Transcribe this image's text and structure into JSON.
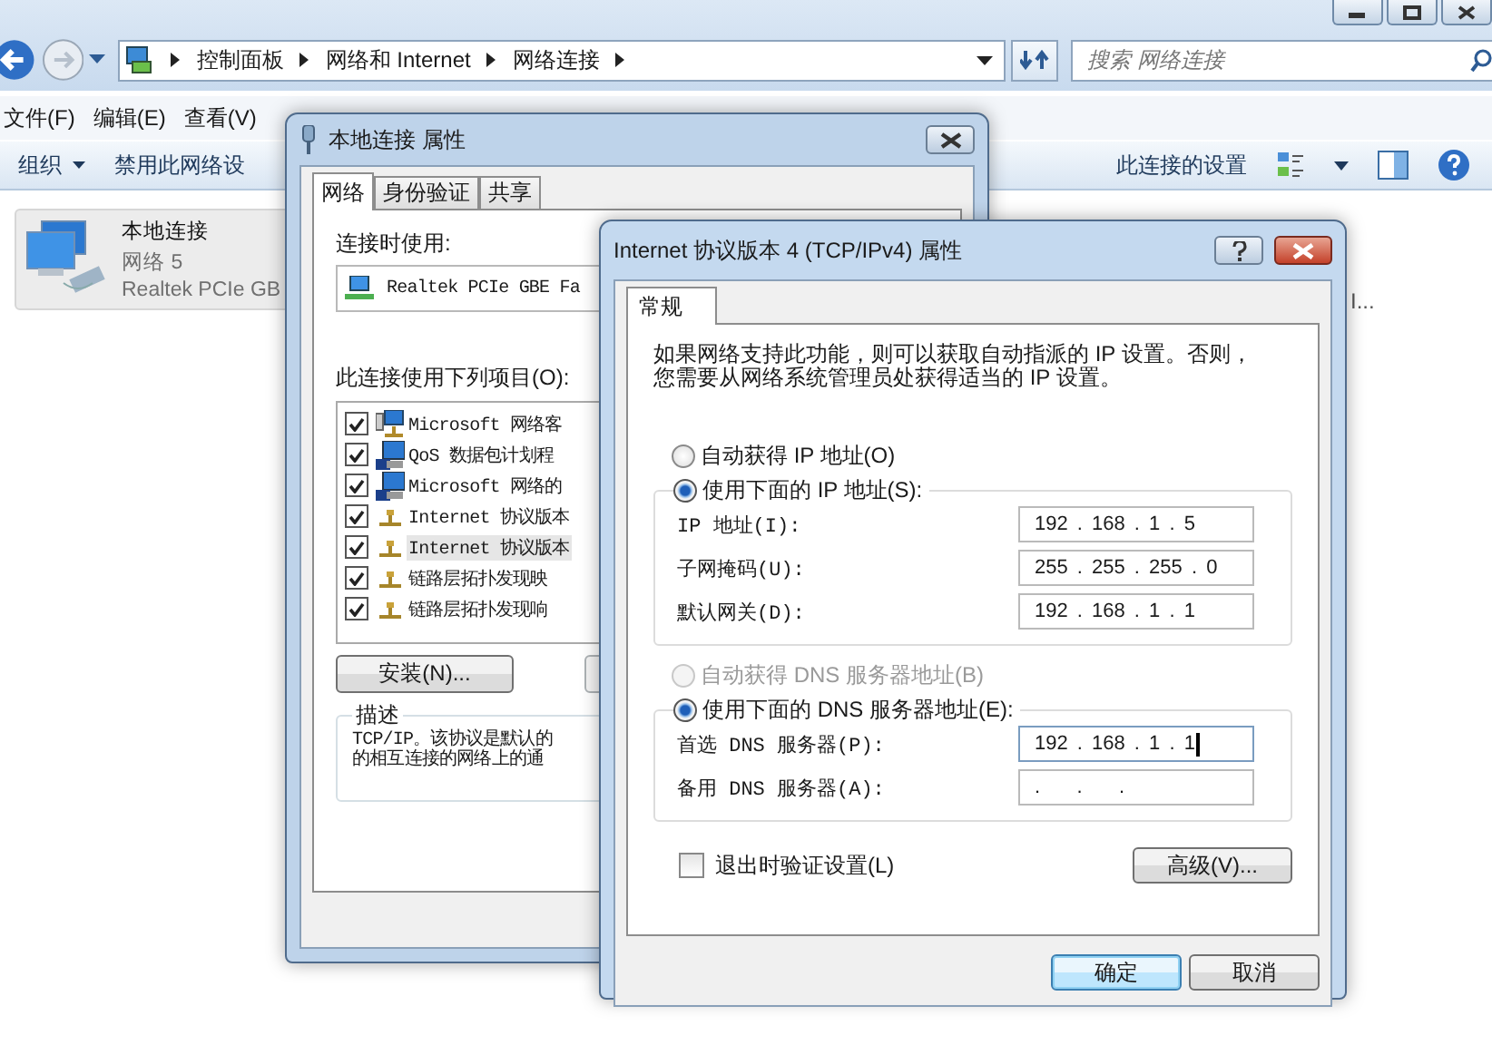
{
  "explorer": {
    "address": {
      "path": [
        "控制面板",
        "网络和 Internet",
        "网络连接"
      ]
    },
    "search": {
      "placeholder": "搜索 网络连接"
    },
    "menu": [
      "文件(F)",
      "编辑(E)",
      "查看(V)"
    ],
    "toolbar": [
      {
        "label": "组织",
        "kind": "dropdown"
      },
      {
        "label": "禁用此网络设",
        "kind": "command"
      }
    ],
    "toolbar_right_command": "此连接的设置",
    "connections": [
      {
        "name": "本地连接",
        "network": "网络 5",
        "adapter": "Realtek PCIe GB",
        "selected": true
      }
    ],
    "connection_2_fragment": "I..."
  },
  "properties_dialog": {
    "title": "本地连接 属性",
    "tabs": [
      {
        "label": "网络",
        "selected": true
      },
      {
        "label": "身份验证",
        "selected": false
      },
      {
        "label": "共享",
        "selected": false
      }
    ],
    "connect_using_label": "连接时使用:",
    "adapter": "Realtek PCIe GBE Fa",
    "items_label": "此连接使用下列项目(O):",
    "items": [
      {
        "label": "Microsoft 网络客",
        "kind": "client",
        "checked": true,
        "selected": false
      },
      {
        "label": "QoS 数据包计划程",
        "kind": "service",
        "checked": true,
        "selected": false
      },
      {
        "label": "Microsoft 网络的",
        "kind": "service",
        "checked": true,
        "selected": false
      },
      {
        "label": "Internet 协议版本",
        "kind": "protocol",
        "checked": true,
        "selected": false
      },
      {
        "label": "Internet 协议版本",
        "kind": "protocol",
        "checked": true,
        "selected": true
      },
      {
        "label": "链路层拓扑发现映",
        "kind": "protocol",
        "checked": true,
        "selected": false
      },
      {
        "label": "链路层拓扑发现响",
        "kind": "protocol",
        "checked": true,
        "selected": false
      }
    ],
    "install_button": "安装(N)...",
    "description": {
      "label": "描述",
      "lines": [
        "TCP/IP。该协议是默认的",
        "的相互连接的网络上的通"
      ]
    }
  },
  "ipv4_dialog": {
    "title": "Internet 协议版本 4 (TCP/IPv4) 属性",
    "tabs": [
      {
        "label": "常规",
        "selected": true
      }
    ],
    "intro": "如果网络支持此功能，则可以获取自动指派的 IP 设置。否则，您需要从网络系统管理员处获得适当的 IP 设置。",
    "ip_auto": {
      "label": "自动获得 IP 地址(O)",
      "selected": false,
      "disabled": false
    },
    "ip_manual": {
      "label": "使用下面的 IP 地址(S):",
      "selected": true,
      "disabled": false
    },
    "ip_fields": [
      {
        "label": "IP 地址(I):",
        "value": "192 . 168 . 1 . 5",
        "focused": false
      },
      {
        "label": "子网掩码(U):",
        "value": "255 . 255 . 255 . 0",
        "focused": false
      },
      {
        "label": "默认网关(D):",
        "value": "192 . 168 . 1 . 1",
        "focused": false
      }
    ],
    "dns_auto": {
      "label": "自动获得 DNS 服务器地址(B)",
      "selected": false,
      "disabled": true
    },
    "dns_manual": {
      "label": "使用下面的 DNS 服务器地址(E):",
      "selected": true,
      "disabled": false
    },
    "dns_fields": [
      {
        "label": "首选 DNS 服务器(P):",
        "value": "192 . 168 . 1 . 1",
        "focused": true
      },
      {
        "label": "备用 DNS 服务器(A):",
        "value": ".    .    .",
        "focused": false
      }
    ],
    "validate": {
      "label": "退出时验证设置(L)",
      "checked": false
    },
    "advanced_button": "高级(V)...",
    "buttons": [
      {
        "label": "确定",
        "default": true
      },
      {
        "label": "取消",
        "default": false
      }
    ]
  }
}
